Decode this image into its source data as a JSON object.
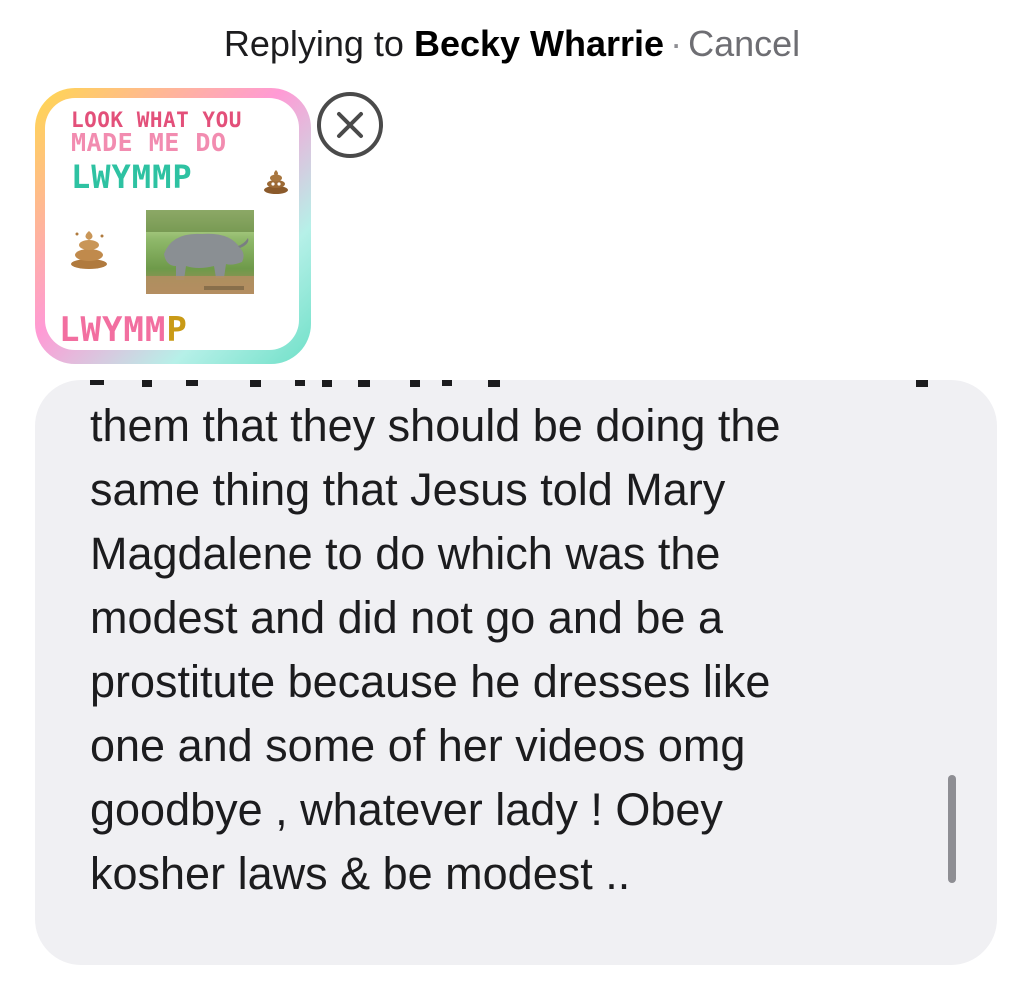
{
  "reply_header": {
    "prefix": "Replying to ",
    "name": "Becky Wharrie",
    "separator": "·",
    "cancel_label": "Cancel"
  },
  "attachment": {
    "line1": "LOOK WHAT YOU",
    "line2": "MADE ME DO",
    "line3": "LWYMMP",
    "line4_main": "LWYMM",
    "line4_last": "P"
  },
  "composer": {
    "text": "them that they should be doing the\nsame thing that Jesus told Mary\nMagdalene to do which was the\nmodest and did not go and be a\nprostitute because he dresses like\none and some of her videos omg\ngoodbye , whatever lady ! Obey\nkosher laws & be modest .."
  },
  "icons": {
    "remove_attachment": "close-circle-icon",
    "emoji": "poop-emoji-icon"
  },
  "colors": {
    "bubble_bg": "#f0f0f3",
    "text": "#1c1c1e",
    "cancel": "#6e6e73"
  }
}
